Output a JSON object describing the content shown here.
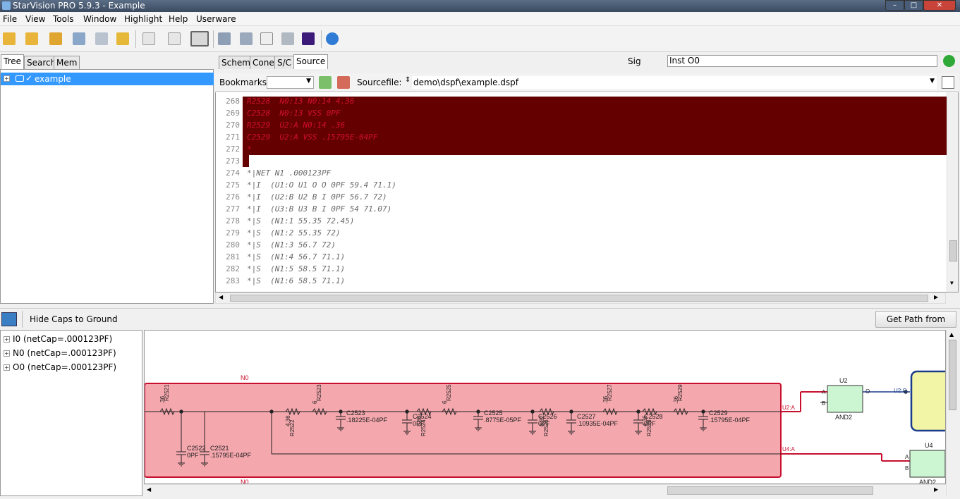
{
  "window": {
    "title": "StarVision PRO 5.9.3 - Example",
    "min": "–",
    "max": "□",
    "close": "✕"
  },
  "menu": [
    "File",
    "View",
    "Tools",
    "Window",
    "Highlight",
    "Help",
    "Userware"
  ],
  "left_tabs": [
    "Tree",
    "Search",
    "Mem"
  ],
  "tree": {
    "root": "example",
    "check": "✓"
  },
  "center_tabs": [
    "Schem",
    "Cone",
    "S/C",
    "Source"
  ],
  "sig": {
    "label": "Sig",
    "value": "Inst O0"
  },
  "bookmarks": {
    "label": "Bookmarks:",
    "value": ""
  },
  "sourcefile": {
    "label": "Sourcefile:",
    "value": "demo\\dspf\\example.dspf"
  },
  "source_lines": [
    {
      "n": "268",
      "t": "R2528  N0:13 N0:14 4.36",
      "hl": true
    },
    {
      "n": "269",
      "t": "C2528  N0:13 VSS 0PF",
      "hl": true
    },
    {
      "n": "270",
      "t": "R2529  U2:A N0:14 .36",
      "hl": true
    },
    {
      "n": "271",
      "t": "C2529  U2:A VSS .15795E-04PF",
      "hl": true
    },
    {
      "n": "272",
      "t": "*",
      "hl": true
    },
    {
      "n": "273",
      "t": "",
      "hl": false
    },
    {
      "n": "274",
      "t": "*|NET N1 .000123PF",
      "hl": false
    },
    {
      "n": "275",
      "t": "*|I  (U1:O U1 O O 0PF 59.4 71.1)",
      "hl": false
    },
    {
      "n": "276",
      "t": "*|I  (U2:B U2 B I 0PF 56.7 72)",
      "hl": false
    },
    {
      "n": "277",
      "t": "*|I  (U3:B U3 B I 0PF 54 71.07)",
      "hl": false
    },
    {
      "n": "278",
      "t": "*|S  (N1:1 55.35 72.45)",
      "hl": false
    },
    {
      "n": "279",
      "t": "*|S  (N1:2 55.35 72)",
      "hl": false
    },
    {
      "n": "280",
      "t": "*|S  (N1:3 56.7 72)",
      "hl": false
    },
    {
      "n": "281",
      "t": "*|S  (N1:4 56.7 71.1)",
      "hl": false
    },
    {
      "n": "282",
      "t": "*|S  (N1:5 58.5 71.1)",
      "hl": false
    },
    {
      "n": "283",
      "t": "*|S  (N1:6 58.5 71.1)",
      "hl": false
    }
  ],
  "bottom": {
    "hide_caps": "Hide Caps to Ground",
    "get_path": "Get Path from Cone"
  },
  "nets": [
    "I0 (netCap=.000123PF)",
    "N0 (netCap=.000123PF)",
    "O0 (netCap=.000123PF)"
  ],
  "schematic": {
    "net_top": "N0",
    "net_bottom": "N0",
    "resistors": [
      {
        "name": "R2521",
        "val": ".36"
      },
      {
        "name": "R2522",
        "val": "4.36"
      },
      {
        "name": "R2523",
        "val": "6"
      },
      {
        "name": "R2524",
        "val": "8.82"
      },
      {
        "name": "R2525",
        "val": "6"
      },
      {
        "name": "R2526",
        "val": "8.82"
      },
      {
        "name": "R2527",
        "val": ".36"
      },
      {
        "name": "R2528",
        "val": "4.36"
      },
      {
        "name": "R2529",
        "val": ".36"
      }
    ],
    "caps": [
      {
        "name": "C2522",
        "val": "0PF"
      },
      {
        "name": "C2521",
        "val": ".15795E-04PF"
      },
      {
        "name": "C2523",
        "val": ".18225E-04PF"
      },
      {
        "name": "C2524",
        "val": "0PF"
      },
      {
        "name": "C2525",
        "val": ".8775E-05PF"
      },
      {
        "name": "C2526",
        "val": "0PF"
      },
      {
        "name": "C2527",
        "val": ".10935E-04PF"
      },
      {
        "name": "C2528",
        "val": "0PF"
      },
      {
        "name": "C2529",
        "val": ".15795E-04PF"
      }
    ],
    "ports": [
      "U2:A",
      "U4:A",
      "U2:O"
    ],
    "gates": [
      {
        "name": "U2",
        "type": "AND2",
        "pins": [
          "A",
          "B",
          "O"
        ]
      },
      {
        "name": "U4",
        "type": "AND2",
        "pins": [
          "A",
          "B"
        ]
      }
    ],
    "colors": {
      "highlight": "#f4a7ad",
      "net": "#c8102e",
      "gate": "#ccf5d2",
      "selected": "#f2f5a6"
    }
  }
}
